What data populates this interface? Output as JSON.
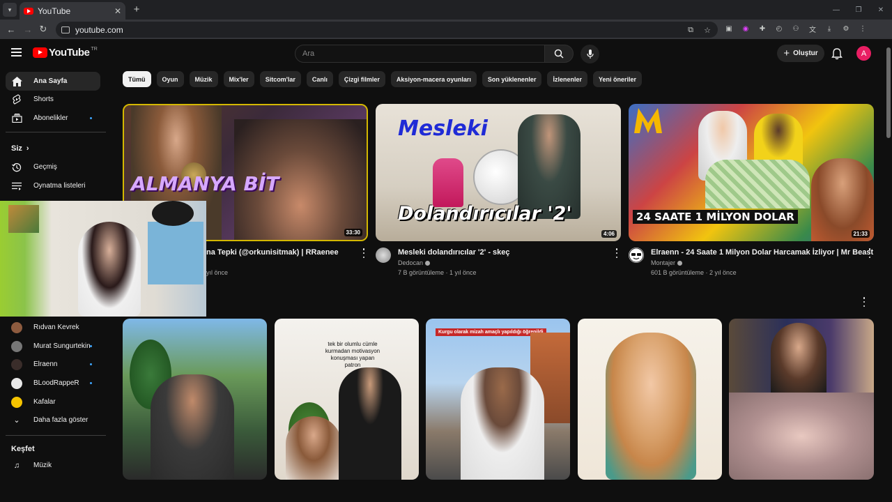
{
  "browser": {
    "tab_title": "YouTube",
    "url": "youtube.com"
  },
  "header": {
    "logo_text": "YouTube",
    "country_code": "TR",
    "search_placeholder": "Ara",
    "create_label": "Oluştur",
    "avatar_letter": "A",
    "brand_color": "#ff0000",
    "avatar_color": "#e91e63"
  },
  "sidebar": {
    "main": [
      {
        "label": "Ana Sayfa",
        "icon": "home-icon"
      },
      {
        "label": "Shorts",
        "icon": "shorts-icon"
      },
      {
        "label": "Abonelikler",
        "icon": "subscriptions-icon"
      }
    ],
    "you_heading": "Siz",
    "you_items": [
      {
        "label": "Geçmiş",
        "icon": "history-icon"
      },
      {
        "label": "Oynatma listeleri",
        "icon": "playlists-icon"
      }
    ],
    "subscriptions": [
      {
        "label": "Rıdvan Kevrek"
      },
      {
        "label": "Murat Sungurtekin"
      },
      {
        "label": "Elraenn"
      },
      {
        "label": "BLoodRappeR"
      },
      {
        "label": "Kafalar"
      }
    ],
    "show_more": "Daha fazla göster",
    "explore_heading": "Keşfet",
    "explore_items": [
      {
        "label": "Müzik",
        "icon": "music-icon"
      }
    ]
  },
  "chips": [
    "Tümü",
    "Oyun",
    "Müzik",
    "Mix'ler",
    "Sitcom'lar",
    "Canlı",
    "Çizgi filmler",
    "Aksiyon-macera oyunları",
    "Son yüklenenler",
    "İzlenenler",
    "Yeni öneriler"
  ],
  "videos": [
    {
      "title": "na Tepki (@orkunisitmak) | RRaenee",
      "meta": "yıl önce",
      "duration": "33:30",
      "overlay": "ALMANYA BİT"
    },
    {
      "title": "Mesleki dolandırıcılar '2' - skeç",
      "channel": "Dedocan",
      "meta": "7 B görüntüleme · 1 yıl önce",
      "duration": "4:06",
      "overlay_top": "Mesleki",
      "overlay_bottom": "Dolandırıcılar '2'"
    },
    {
      "title": "Elraenn - 24 Saate 1 Milyon Dolar Harcamak İzliyor | Mr Beast",
      "channel": "Montajer",
      "meta": "601 B görüntüleme · 2 yıl önce",
      "duration": "21:33",
      "overlay": "24 SAATE 1 MİLYON DOLAR"
    }
  ],
  "shorts": [
    {
      "overlay": ""
    },
    {
      "overlay": "tek bir olumlu cümle kurmadan motivasyon konuşması yapan patron"
    },
    {
      "overlay": "Kurgu olarak mizah amaçlı yapıldığı öğrenildi"
    },
    {
      "overlay": ""
    },
    {
      "overlay": ""
    }
  ]
}
